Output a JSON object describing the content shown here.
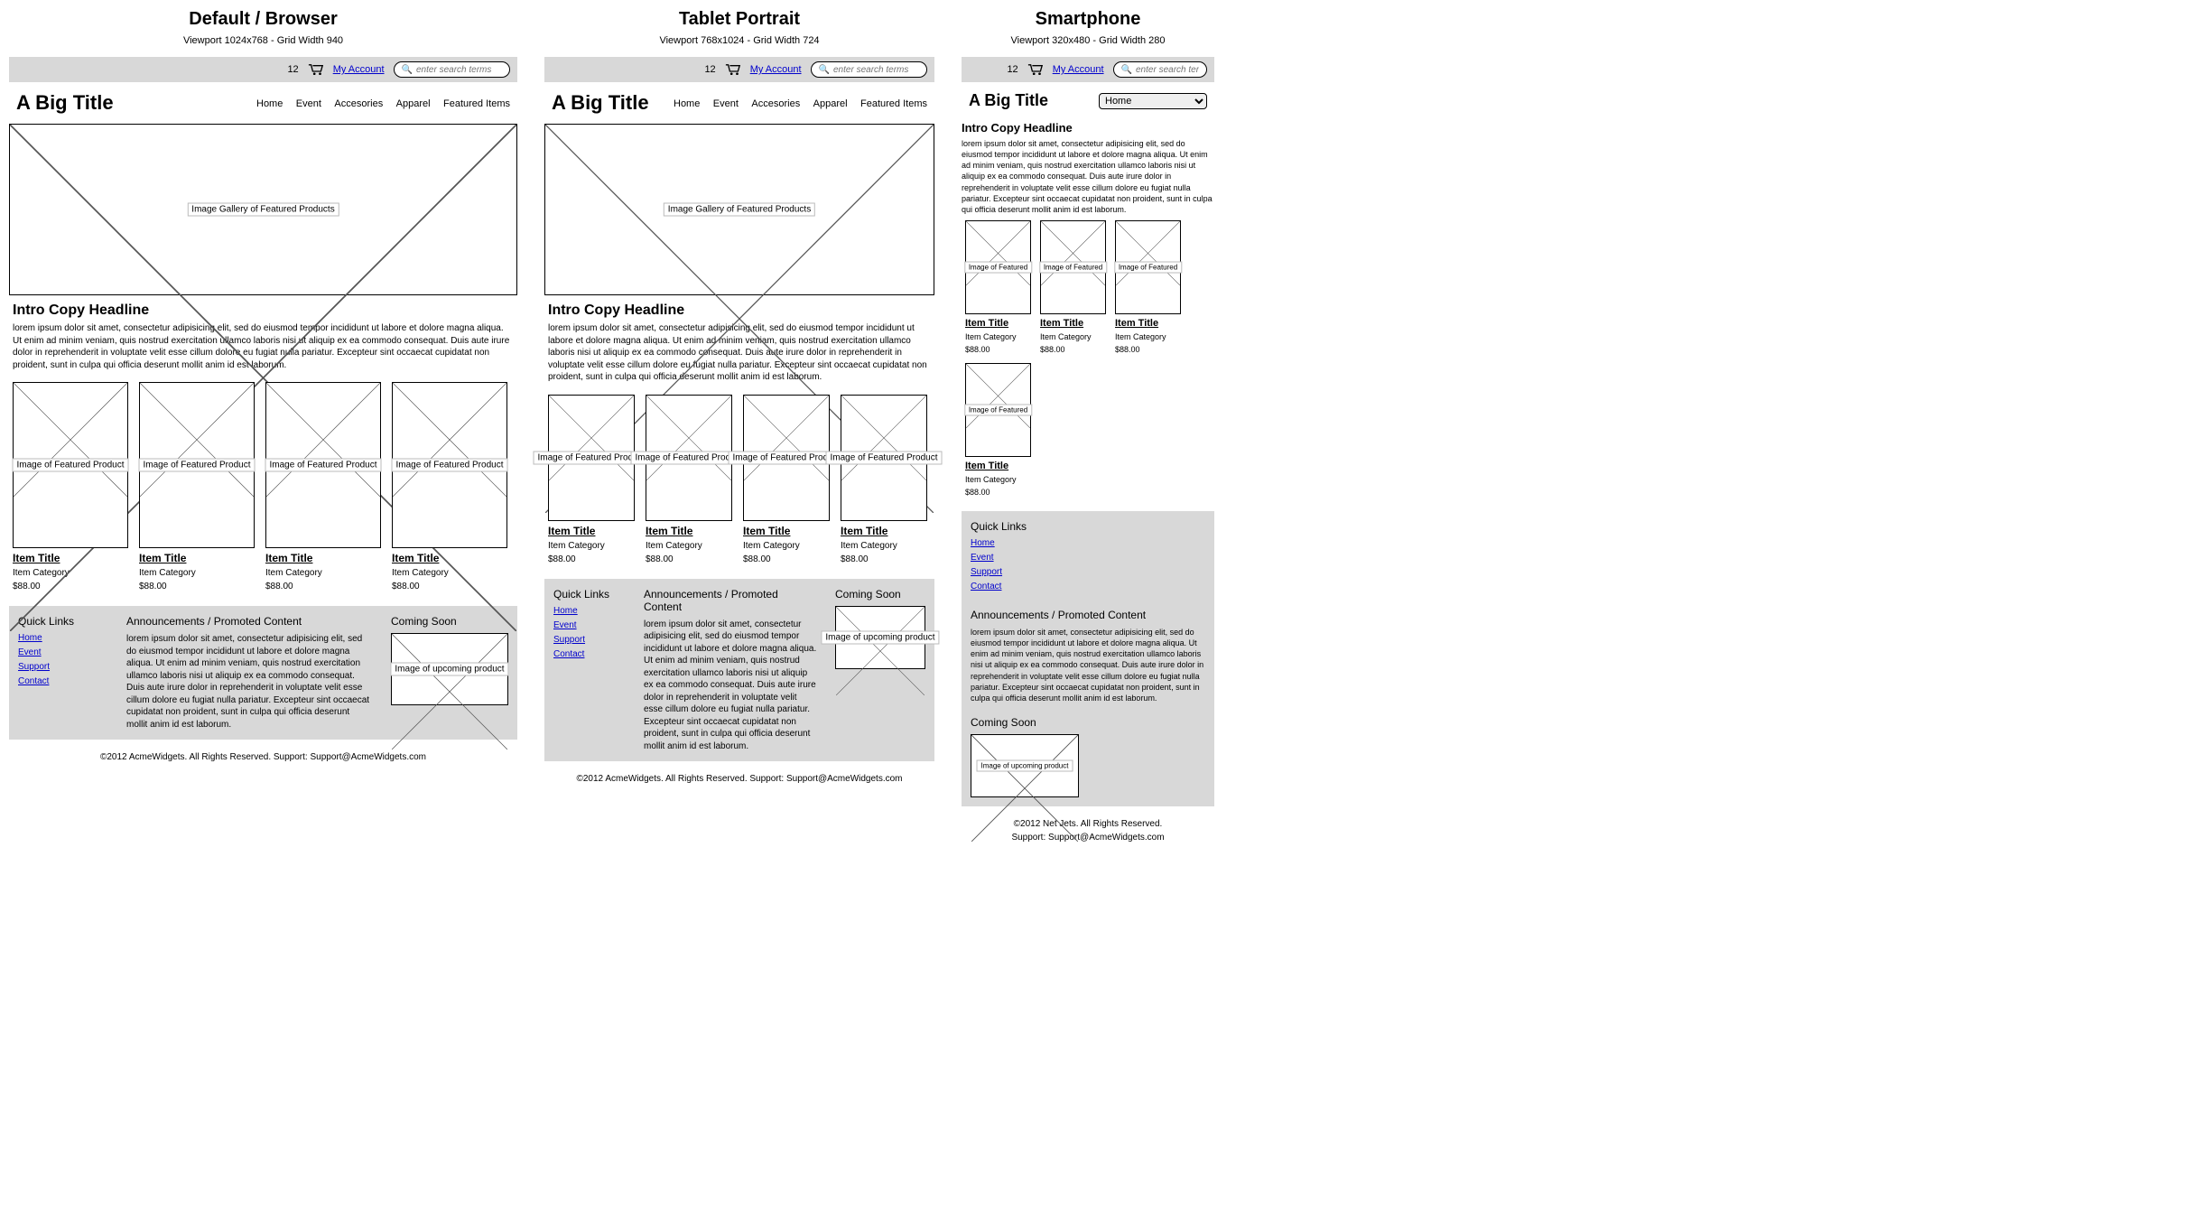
{
  "layouts": [
    {
      "title": "Default / Browser",
      "sub": "Viewport 1024x768 - Grid Width 940"
    },
    {
      "title": "Tablet Portrait",
      "sub": "Viewport 768x1024 - Grid Width 724"
    },
    {
      "title": "Smartphone",
      "sub": "Viewport 320x480 - Grid Width 280"
    }
  ],
  "topbar": {
    "cart_count": "12",
    "account": "My Account",
    "search_placeholder": "enter search terms"
  },
  "title": "A Big Title",
  "nav": [
    "Home",
    "Event",
    "Accesories",
    "Apparel",
    "Featured Items"
  ],
  "nav_select": "Home",
  "hero_label": "Image Gallery of Featured Products",
  "intro": {
    "headline": "Intro Copy Headline",
    "body": "lorem ipsum dolor sit amet, consectetur adipisicing elit, sed do eiusmod tempor incididunt ut labore et dolore magna aliqua. Ut enim ad minim veniam, quis nostrud exercitation ullamco laboris nisi ut aliquip ex ea commodo consequat. Duis aute irure dolor in reprehenderit in voluptate velit esse cillum dolore eu fugiat nulla pariatur. Excepteur sint occaecat cupidatat non proident, sunt in culpa qui officia deserunt mollit anim id est laborum."
  },
  "card_img_label_full": "Image of Featured Product",
  "card_img_label_short": "Image of Featured",
  "card": {
    "title": "Item Title",
    "cat": "Item Category",
    "price": "$88.00"
  },
  "footer": {
    "quick_links_title": "Quick Links",
    "links": [
      "Home",
      "Event",
      "Support",
      "Contact"
    ],
    "ann_title": "Announcements / Promoted Content",
    "ann_body": "lorem ipsum dolor sit amet, consectetur adipisicing elit, sed do eiusmod tempor incididunt ut labore et dolore magna aliqua. Ut enim ad minim veniam, quis nostrud exercitation ullamco laboris nisi ut aliquip ex ea commodo consequat. Duis aute irure dolor in reprehenderit in voluptate velit esse cillum dolore eu fugiat nulla pariatur. Excepteur sint occaecat cupidatat non proident, sunt in culpa qui officia deserunt mollit anim id est laborum.",
    "coming_title": "Coming Soon",
    "coming_label": "Image of upcoming product"
  },
  "copyright_main": "©2012 AcmeWidgets.   All Rights Reserved.   Support: Support@AcmeWidgets.com",
  "copyright_phone_a": "©2012 Net Jets.   All Rights Reserved.",
  "copyright_phone_b": "Support: Support@AcmeWidgets.com"
}
